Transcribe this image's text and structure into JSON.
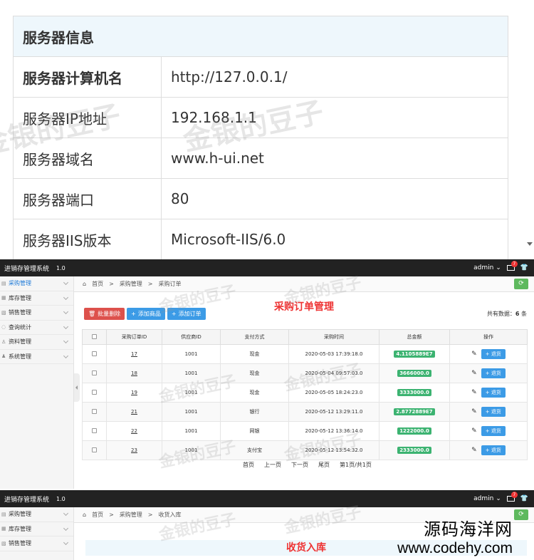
{
  "server": {
    "heading": "服务器信息",
    "rows": [
      {
        "label": "服务器计算机名",
        "value": "http://127.0.0.1/"
      },
      {
        "label": "服务器IP地址",
        "value": "192.168.1.1"
      },
      {
        "label": "服务器域名",
        "value": "www.h-ui.net"
      },
      {
        "label": "服务器端口",
        "value": "80"
      },
      {
        "label": "服务器IIS版本",
        "value": "Microsoft-IIS/6.0"
      }
    ]
  },
  "app": {
    "title": "进销存管理系统",
    "version": "1.0",
    "user": "admin",
    "mail_count": "7"
  },
  "sidebar1": [
    "采购管理",
    "库存管理",
    "销售管理",
    "查询统计",
    "资料管理",
    "系统管理"
  ],
  "sidebar2": [
    "采购管理",
    "库存管理",
    "销售管理"
  ],
  "crumb1": {
    "home": "首页",
    "sep": ">",
    "section": "采购管理",
    "page": "采购订单"
  },
  "crumb2": {
    "home": "首页",
    "sep": ">",
    "section": "采购管理",
    "page": "收货入库"
  },
  "heading1": "采购订单管理",
  "heading2": "收货入库",
  "buttons": {
    "batch_delete": "批量删除",
    "add_goods": "添加商品",
    "add_order": "添加订单"
  },
  "total": {
    "prefix": "共有数据：",
    "count": "6",
    "suffix": " 条"
  },
  "table": {
    "headers": [
      "",
      "采购订单ID",
      "供应商ID",
      "支付方式",
      "采购时间",
      "总金额",
      "操作"
    ],
    "rows": [
      {
        "id": "17",
        "supplier": "1001",
        "pay": "现金",
        "time": "2020-05-03 17:39:18.0",
        "amount": "4.1105889E7"
      },
      {
        "id": "18",
        "supplier": "1001",
        "pay": "现金",
        "time": "2020-05-04 09:57:03.0",
        "amount": "3666000.0"
      },
      {
        "id": "19",
        "supplier": "1001",
        "pay": "现金",
        "time": "2020-05-05 18:24:23.0",
        "amount": "3333000.0"
      },
      {
        "id": "21",
        "supplier": "1001",
        "pay": "银行",
        "time": "2020-05-12 13:29:11.0",
        "amount": "2.8772889E7"
      },
      {
        "id": "22",
        "supplier": "1001",
        "pay": "网银",
        "time": "2020-05-12 13:36:14.0",
        "amount": "1222000.0"
      },
      {
        "id": "23",
        "supplier": "1001",
        "pay": "支付宝",
        "time": "2020-05-12 13:54:32.0",
        "amount": "2333000.0"
      }
    ],
    "return_label": "退货"
  },
  "pager": [
    "首页",
    "上一页",
    "下一页",
    "尾页",
    "第1页/共1页"
  ],
  "watermark": "金银的豆子",
  "brand": {
    "cn": "源码海洋网",
    "url": "www.codehy.com"
  }
}
